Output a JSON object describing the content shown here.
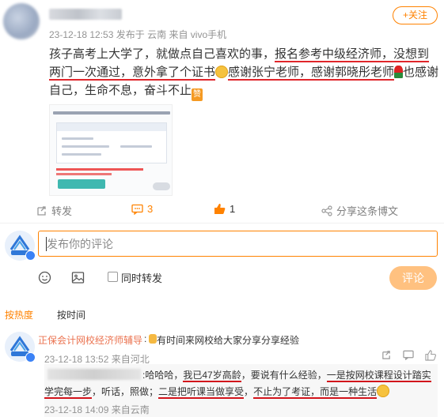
{
  "post": {
    "meta_time": "23-12-18 12:53",
    "meta_location": "发布于 云南",
    "meta_source": "来自 vivo手机",
    "follow_label": "+关注",
    "text_p1": "孩子高考上大学了，就做点自己喜欢的事，",
    "text_u1": "报名参考中级经济师，没想到两门一次",
    "text_u2": "通过，意外拿了个证书",
    "text_u3": "感谢张宁老师，感谢郭晓彤老师",
    "text_p2": "也感谢自己，生命不息，奋斗不止",
    "emoji_badge": "赞"
  },
  "actions": {
    "repost_label": "转发",
    "comment_count": "3",
    "like_count": "1",
    "share_label": "分享这条博文"
  },
  "composer": {
    "placeholder": "发布你的评论",
    "also_repost_label": "同时转发",
    "submit_label": "评论"
  },
  "sort": {
    "hot_label": "按热度",
    "time_label": "按时间"
  },
  "comment": {
    "author": "正保会计网校经济师辅导",
    "colon": ":",
    "text": "有时间来网校给大家分享分享经验",
    "time": "23-12-18 13:52",
    "source": "来自河北"
  },
  "reply": {
    "p1": ":哈哈哈，",
    "u1": "我已47岁高龄",
    "p2": "，要说有什么经验，",
    "u2": "一是按网校课程设计踏实学完每一步",
    "p3": "，听话，照做；",
    "u3": "二是把听课当做享受",
    "p4": "，",
    "u4": "不止为了考证，而是一种生活",
    "time": "23-12-18 14:09",
    "source": "来自云南"
  },
  "colors": {
    "accent": "#ff8200",
    "underline": "#e0262a",
    "author": "#eb7350",
    "meta": "#939393"
  },
  "icons": [
    "repost-icon",
    "comment-icon",
    "like-icon",
    "share-icon",
    "emoji-icon",
    "image-icon",
    "reply-icon",
    "heart-icon"
  ]
}
